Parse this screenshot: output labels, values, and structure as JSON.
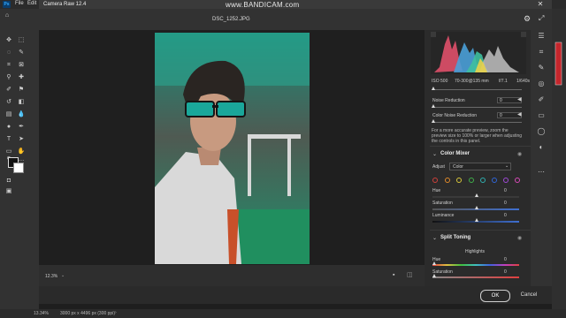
{
  "app": {
    "logo": "Ps",
    "menu": [
      "File",
      "Edit"
    ]
  },
  "window": {
    "title": "Camera Raw 12.4"
  },
  "watermark": "www.BANDICAM.com",
  "document": {
    "filename": "DSC_1252.JPG"
  },
  "canvas": {
    "zoom": "12.3%"
  },
  "camera_info": {
    "iso": "ISO 500",
    "lens": "70-300@135 mm",
    "aperture": "f/7.1",
    "shutter": "1/640s"
  },
  "detail": {
    "noise_reduction": {
      "label": "Noise Reduction",
      "value": "0"
    },
    "color_noise_reduction": {
      "label": "Color Noise Reduction",
      "value": "0"
    },
    "hint": [
      "For a more accurate preview, zoom the",
      "preview size to 100% or larger when adjusting",
      "the controls in this panel."
    ]
  },
  "color_mixer": {
    "title": "Color Mixer",
    "adjust_label": "Adjust",
    "adjust_value": "Color",
    "swatches": [
      "#d0403a",
      "#e08a2a",
      "#d9c83a",
      "#3fae4a",
      "#2fb0b0",
      "#2f66d8",
      "#a04ad8",
      "#d84ab8"
    ],
    "hue": {
      "label": "Hue",
      "value": "0"
    },
    "saturation": {
      "label": "Saturation",
      "value": "0"
    },
    "luminance": {
      "label": "Luminance",
      "value": "0"
    }
  },
  "split_toning": {
    "title": "Split Toning",
    "highlights": "Highlights",
    "hue": {
      "label": "Hue",
      "value": "0"
    },
    "saturation": {
      "label": "Saturation",
      "value": "0"
    }
  },
  "buttons": {
    "ok": "OK",
    "cancel": "Cancel"
  },
  "status": {
    "zoom": "13.34%",
    "doc_size": "3000 px x 4496 px (300 ppi)"
  }
}
